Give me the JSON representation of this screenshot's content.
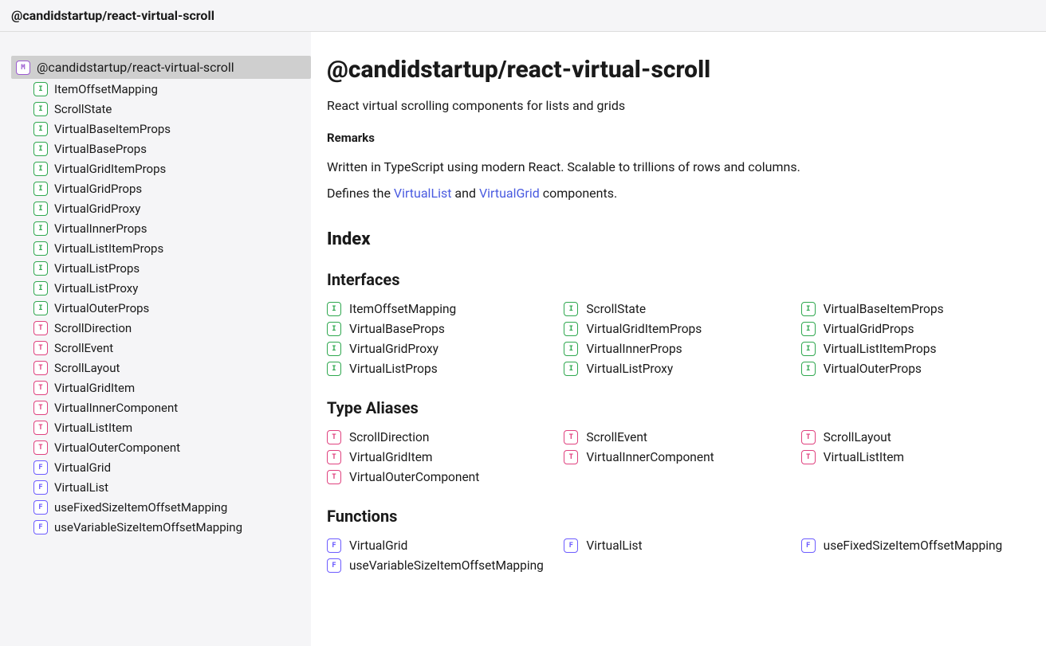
{
  "header": {
    "title": "@candidstartup/react-virtual-scroll"
  },
  "sidebar": {
    "root": {
      "kind": "M",
      "label": "@candidstartup/react-virtual-scroll"
    },
    "items": [
      {
        "kind": "I",
        "label": "ItemOffsetMapping"
      },
      {
        "kind": "I",
        "label": "ScrollState"
      },
      {
        "kind": "I",
        "label": "VirtualBaseItemProps"
      },
      {
        "kind": "I",
        "label": "VirtualBaseProps"
      },
      {
        "kind": "I",
        "label": "VirtualGridItemProps"
      },
      {
        "kind": "I",
        "label": "VirtualGridProps"
      },
      {
        "kind": "I",
        "label": "VirtualGridProxy"
      },
      {
        "kind": "I",
        "label": "VirtualInnerProps"
      },
      {
        "kind": "I",
        "label": "VirtualListItemProps"
      },
      {
        "kind": "I",
        "label": "VirtualListProps"
      },
      {
        "kind": "I",
        "label": "VirtualListProxy"
      },
      {
        "kind": "I",
        "label": "VirtualOuterProps"
      },
      {
        "kind": "T",
        "label": "ScrollDirection"
      },
      {
        "kind": "T",
        "label": "ScrollEvent"
      },
      {
        "kind": "T",
        "label": "ScrollLayout"
      },
      {
        "kind": "T",
        "label": "VirtualGridItem"
      },
      {
        "kind": "T",
        "label": "VirtualInnerComponent"
      },
      {
        "kind": "T",
        "label": "VirtualListItem"
      },
      {
        "kind": "T",
        "label": "VirtualOuterComponent"
      },
      {
        "kind": "F",
        "label": "VirtualGrid"
      },
      {
        "kind": "F",
        "label": "VirtualList"
      },
      {
        "kind": "F",
        "label": "useFixedSizeItemOffsetMapping"
      },
      {
        "kind": "F",
        "label": "useVariableSizeItemOffsetMapping"
      }
    ]
  },
  "main": {
    "title": "@candidstartup/react-virtual-scroll",
    "summary": "React virtual scrolling components for lists and grids",
    "remarks_label": "Remarks",
    "remarks_text": "Written in TypeScript using modern React. Scalable to trillions of rows and columns.",
    "defines_prefix": "Defines the ",
    "defines_link1": "VirtualList",
    "defines_mid": " and ",
    "defines_link2": "VirtualGrid",
    "defines_suffix": " components.",
    "index_heading": "Index",
    "sections": {
      "interfaces": {
        "heading": "Interfaces",
        "items": [
          {
            "kind": "I",
            "label": "ItemOffsetMapping"
          },
          {
            "kind": "I",
            "label": "ScrollState"
          },
          {
            "kind": "I",
            "label": "VirtualBaseItemProps"
          },
          {
            "kind": "I",
            "label": "VirtualBaseProps"
          },
          {
            "kind": "I",
            "label": "VirtualGridItemProps"
          },
          {
            "kind": "I",
            "label": "VirtualGridProps"
          },
          {
            "kind": "I",
            "label": "VirtualGridProxy"
          },
          {
            "kind": "I",
            "label": "VirtualInnerProps"
          },
          {
            "kind": "I",
            "label": "VirtualListItemProps"
          },
          {
            "kind": "I",
            "label": "VirtualListProps"
          },
          {
            "kind": "I",
            "label": "VirtualListProxy"
          },
          {
            "kind": "I",
            "label": "VirtualOuterProps"
          }
        ]
      },
      "type_aliases": {
        "heading": "Type Aliases",
        "items": [
          {
            "kind": "T",
            "label": "ScrollDirection"
          },
          {
            "kind": "T",
            "label": "ScrollEvent"
          },
          {
            "kind": "T",
            "label": "ScrollLayout"
          },
          {
            "kind": "T",
            "label": "VirtualGridItem"
          },
          {
            "kind": "T",
            "label": "VirtualInnerComponent"
          },
          {
            "kind": "T",
            "label": "VirtualListItem"
          },
          {
            "kind": "T",
            "label": "VirtualOuterComponent"
          }
        ]
      },
      "functions": {
        "heading": "Functions",
        "items": [
          {
            "kind": "F",
            "label": "VirtualGrid"
          },
          {
            "kind": "F",
            "label": "VirtualList"
          },
          {
            "kind": "F",
            "label": "useFixedSizeItemOffsetMapping"
          },
          {
            "kind": "F",
            "label": "useVariableSizeItemOffsetMapping"
          }
        ]
      }
    }
  }
}
